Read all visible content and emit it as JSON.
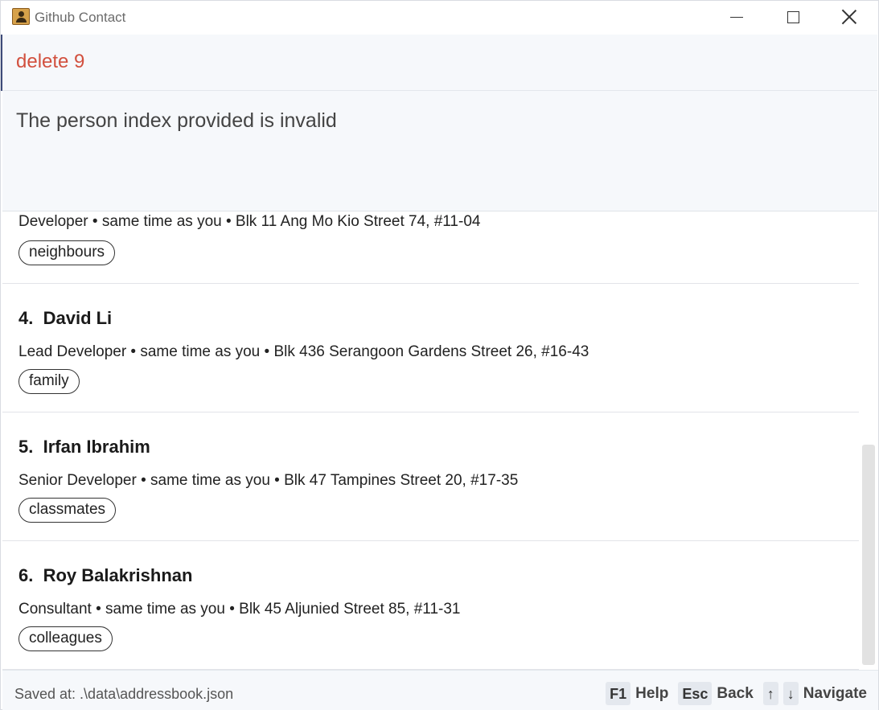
{
  "window": {
    "title": "Github Contact"
  },
  "command": {
    "value": "delete 9"
  },
  "result": {
    "message": "The person index provided is invalid"
  },
  "persons": [
    {
      "index": "",
      "name": "",
      "details": "Developer • same time as you • Blk 11 Ang Mo Kio Street 74, #11-04",
      "tag": "neighbours"
    },
    {
      "index": "4.",
      "name": "David Li",
      "details": "Lead Developer • same time as you • Blk 436 Serangoon Gardens Street 26, #16-43",
      "tag": "family"
    },
    {
      "index": "5.",
      "name": "Irfan Ibrahim",
      "details": "Senior Developer • same time as you • Blk 47 Tampines Street 20, #17-35",
      "tag": "classmates"
    },
    {
      "index": "6.",
      "name": "Roy Balakrishnan",
      "details": "Consultant • same time as you • Blk 45 Aljunied Street 85, #11-31",
      "tag": "colleagues"
    }
  ],
  "status": {
    "saved": "Saved at: .\\data\\addressbook.json",
    "hints": {
      "help_key": "F1",
      "help_label": "Help",
      "back_key": "Esc",
      "back_label": "Back",
      "up_key": "↑",
      "down_key": "↓",
      "navigate_label": "Navigate"
    }
  },
  "colors": {
    "command_text": "#d2503e",
    "panel_bg": "#f6f8fb"
  }
}
